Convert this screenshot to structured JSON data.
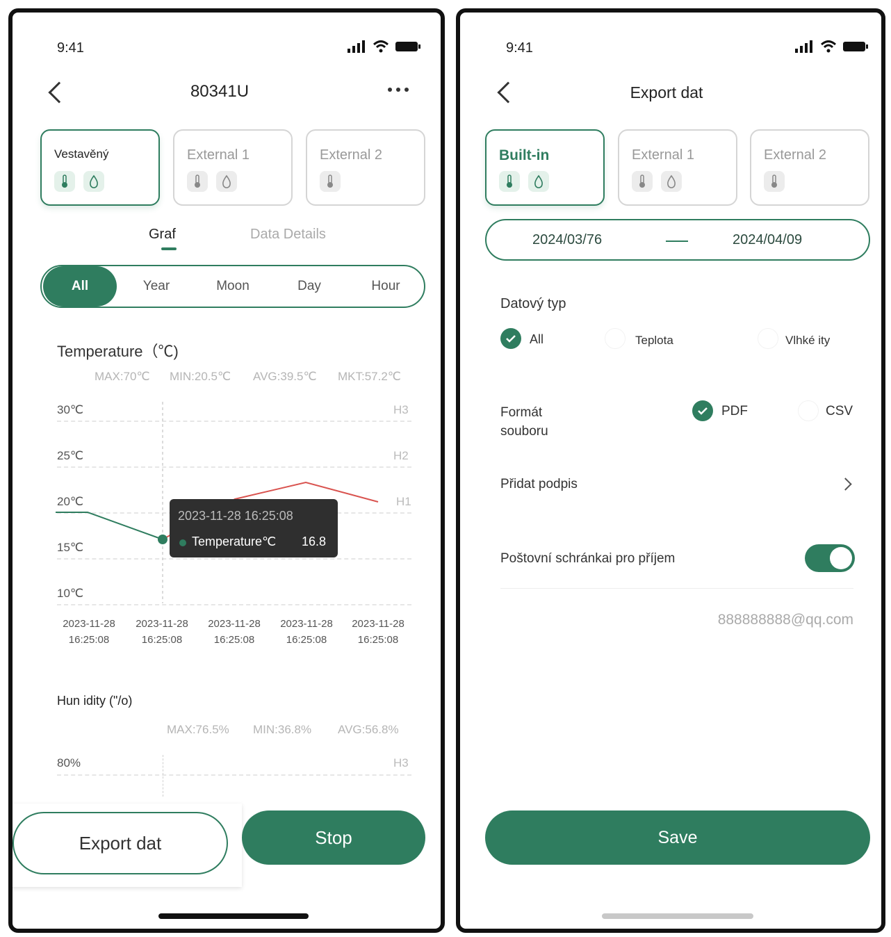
{
  "left": {
    "status_time": "9:41",
    "title": "80341U",
    "more_icon": "more-horizontal-icon",
    "sensor_cards": [
      {
        "label": "Vestavěný",
        "icons": [
          "thermometer",
          "droplet"
        ],
        "active": true
      },
      {
        "label": "External 1",
        "icons": [
          "thermometer",
          "droplet"
        ],
        "active": false
      },
      {
        "label": "External 2",
        "icons": [
          "thermometer"
        ],
        "active": false
      }
    ],
    "tabs": [
      "Graf",
      "Data Details"
    ],
    "periods": [
      "All",
      "Year",
      "Moon",
      "Day",
      "Hour"
    ],
    "temperature": {
      "title": "Temperature（℃)",
      "stats": [
        "MAX:70℃",
        "MIN:20.5℃",
        "AVG:39.5℃",
        "MKT:57.2℃"
      ],
      "y_labels": [
        "30℃",
        "25℃",
        "20℃",
        "15℃",
        "10℃"
      ],
      "threshold_labels": [
        "H3",
        "H2",
        "H1"
      ],
      "x_labels": [
        [
          "2023-11-28",
          "16:25:08"
        ],
        [
          "2023-11-28",
          "16:25:08"
        ],
        [
          "2023-11-28",
          "16:25:08"
        ],
        [
          "2023-11-28",
          "16:25:08"
        ],
        [
          "2023-11-28",
          "16:25:08"
        ]
      ],
      "tooltip": {
        "time": "2023-11-28 16:25:08",
        "label": "Temperature℃",
        "value": "16.8"
      }
    },
    "humidity": {
      "title": "Hun idity (\"/o)",
      "stats": [
        "MAX:76.5%",
        "MIN:36.8%",
        "AVG:56.8%"
      ],
      "y_labels": [
        "80%"
      ],
      "threshold_labels": [
        "H3"
      ]
    },
    "export_button": "Export dat",
    "stop_button": "Stop"
  },
  "right": {
    "status_time": "9:41",
    "title": "Export dat",
    "sensor_cards": [
      {
        "label": "Built-in",
        "icons": [
          "thermometer",
          "droplet"
        ],
        "active": true
      },
      {
        "label": "External 1",
        "icons": [
          "thermometer",
          "droplet"
        ],
        "active": false
      },
      {
        "label": "External 2",
        "icons": [
          "thermometer"
        ],
        "active": false
      }
    ],
    "date_start": "2024/03/76",
    "date_end": "2024/04/09",
    "data_type": {
      "label": "Datový typ",
      "options": [
        {
          "label": "All",
          "checked": true
        },
        {
          "label": "Teplota",
          "checked": false
        },
        {
          "label": "Vlhké ity",
          "checked": false
        }
      ]
    },
    "file_format": {
      "label_line1": "Formát",
      "label_line2": "souboru",
      "options": [
        {
          "label": "PDF",
          "checked": true
        },
        {
          "label": "CSV",
          "checked": false
        }
      ]
    },
    "signature_label": "Přidat podpis",
    "mailbox_label": "Poštovní schránkai pro příjem",
    "mailbox_enabled": true,
    "email": "888888888@qq.com",
    "save_button": "Save"
  },
  "colors": {
    "accent": "#2f7d5f",
    "line_red": "#d9534f",
    "tooltip_bg": "#2f2f2f"
  }
}
